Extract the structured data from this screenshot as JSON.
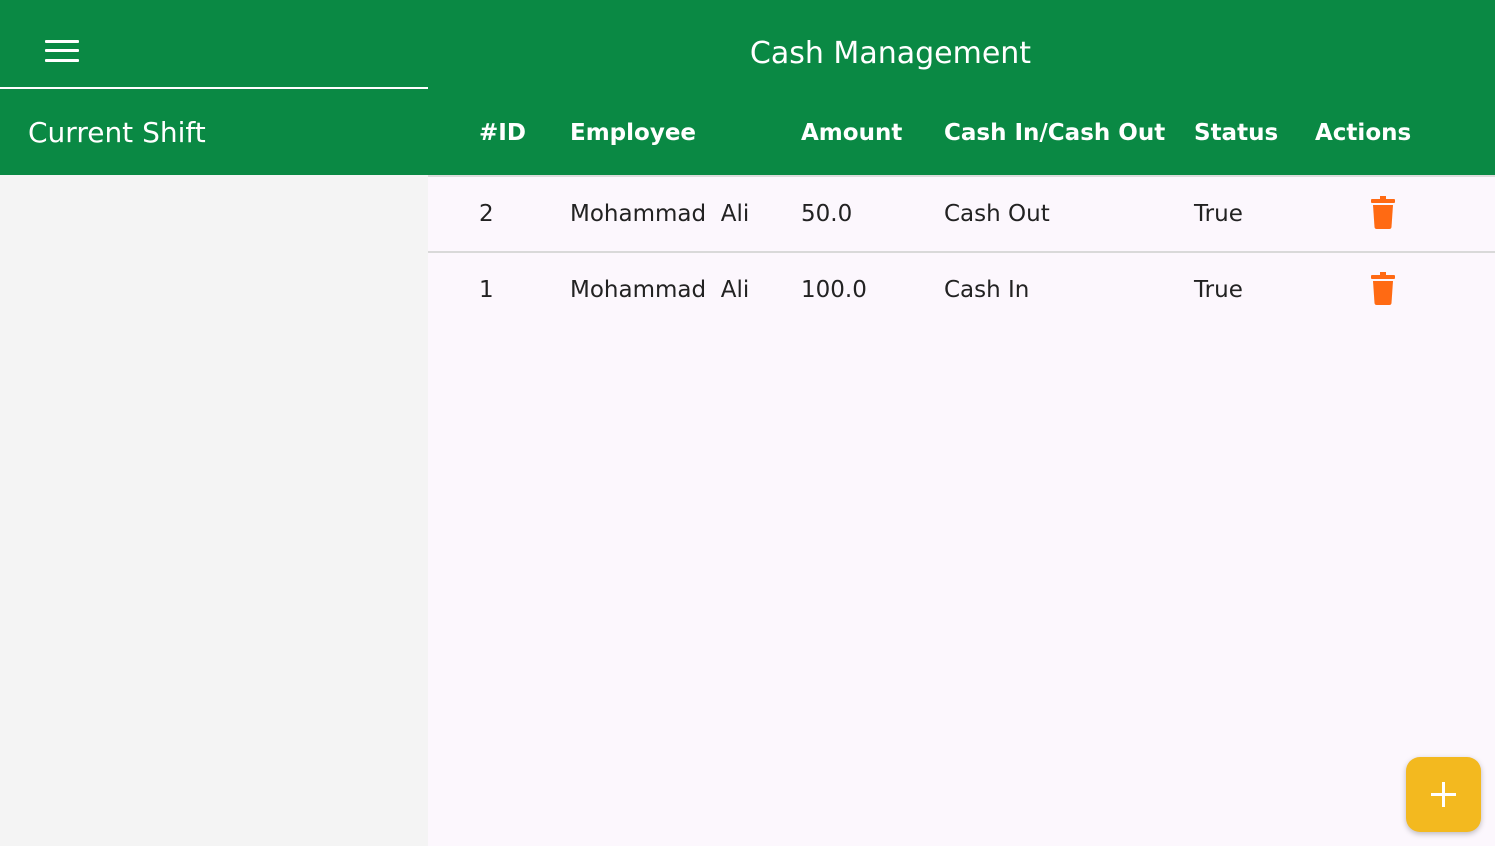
{
  "app": {
    "title": "Cash Management"
  },
  "sidebar": {
    "title": "Current Shift"
  },
  "table": {
    "headers": {
      "id": "#ID",
      "employee": "Employee",
      "amount": "Amount",
      "cash_type": "Cash In/Cash Out",
      "status": "Status",
      "actions": "Actions"
    },
    "rows": [
      {
        "id": "2",
        "employee": "Mohammad  Ali",
        "amount": "50.0",
        "cash_type": "Cash Out",
        "status": "True",
        "action_icon": "trash-icon"
      },
      {
        "id": "1",
        "employee": "Mohammad  Ali",
        "amount": "100.0",
        "cash_type": "Cash In",
        "status": "True",
        "action_icon": "trash-icon"
      }
    ]
  },
  "fab": {
    "icon": "plus-icon"
  },
  "colors": {
    "primary": "#0a8944",
    "delete": "#ff6a13",
    "fab": "#f3b91f",
    "sidebar_bg": "#f4f4f4",
    "content_bg": "#fcf7fd"
  }
}
